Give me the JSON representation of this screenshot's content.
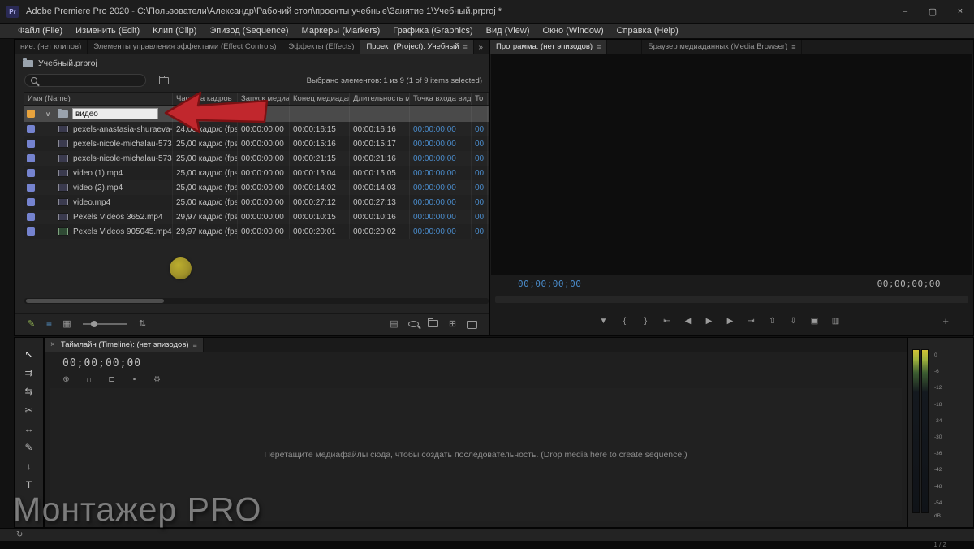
{
  "window": {
    "app_initials": "Pr",
    "title": "Adobe Premiere Pro 2020 - C:\\Пользователи\\Александр\\Рабочий стол\\проекты учебные\\Занятие 1\\Учебный.prproj *",
    "minimize": "–",
    "maximize": "▢",
    "close": "×"
  },
  "menu_bar": {
    "items": [
      "Файл (File)",
      "Изменить (Edit)",
      "Клип (Clip)",
      "Эпизод (Sequence)",
      "Маркеры (Markers)",
      "Графика (Graphics)",
      "Вид (View)",
      "Окно (Window)",
      "Справка (Help)"
    ]
  },
  "panels": {
    "left_tabs": [
      {
        "label": "ние: (нет клипов)",
        "active": false,
        "menu": false
      },
      {
        "label": "Элементы управления эффектами (Effect Controls)",
        "active": false,
        "menu": false
      },
      {
        "label": "Эффекты (Effects)",
        "active": false,
        "menu": false
      },
      {
        "label": "Проект (Project): Учебный",
        "active": true,
        "menu": true
      }
    ],
    "tabs_overflow": "»",
    "right_tabs": [
      {
        "label": "Программа: (нет эпизодов)",
        "active": true,
        "menu": true,
        "offset": false
      },
      {
        "label": "Браузер медиаданных (Media Browser)",
        "active": false,
        "menu": true,
        "offset": true
      }
    ]
  },
  "project_panel": {
    "project_name": "Учебный.prproj",
    "selection_status": "Выбрано элементов: 1 из 9 (1 of 9 items selected)",
    "columns": [
      "Имя (Name)",
      "Частота кадров",
      "Запуск медиадан",
      "Конец медиаданн",
      "Длительность ме",
      "Точка входа виде",
      "То"
    ],
    "bin_rename": {
      "value": "видео"
    },
    "rows": [
      {
        "name": "pexels-anastasia-shuraeva-",
        "fps": "24,00 кадр/с (fps)",
        "start": "00:00:00:00",
        "end": "00:00:16:15",
        "duration": "00:00:16:16",
        "in": "00:00:00:00",
        "more": "00"
      },
      {
        "name": "pexels-nicole-michalau-573",
        "fps": "25,00 кадр/с (fps)",
        "start": "00:00:00:00",
        "end": "00:00:15:16",
        "duration": "00:00:15:17",
        "in": "00:00:00:00",
        "more": "00"
      },
      {
        "name": "pexels-nicole-michalau-573",
        "fps": "25,00 кадр/с (fps)",
        "start": "00:00:00:00",
        "end": "00:00:21:15",
        "duration": "00:00:21:16",
        "in": "00:00:00:00",
        "more": "00"
      },
      {
        "name": "video (1).mp4",
        "fps": "25,00 кадр/с (fps)",
        "start": "00:00:00:00",
        "end": "00:00:15:04",
        "duration": "00:00:15:05",
        "in": "00:00:00:00",
        "more": "00"
      },
      {
        "name": "video (2).mp4",
        "fps": "25,00 кадр/с (fps)",
        "start": "00:00:00:00",
        "end": "00:00:14:02",
        "duration": "00:00:14:03",
        "in": "00:00:00:00",
        "more": "00"
      },
      {
        "name": "video.mp4",
        "fps": "25,00 кадр/с (fps)",
        "start": "00:00:00:00",
        "end": "00:00:27:12",
        "duration": "00:00:27:13",
        "in": "00:00:00:00",
        "more": "00"
      },
      {
        "name": "Pexels Videos 3652.mp4",
        "fps": "29,97 кадр/с (fps)",
        "start": "00:00:00:00",
        "end": "00:00:10:15",
        "duration": "00:00:10:16",
        "in": "00:00:00:00",
        "more": "00"
      },
      {
        "name": "Pexels Videos 905045.mp4",
        "fps": "29,97 кадр/с (fps)",
        "start": "00:00:00:00",
        "end": "00:00:20:01",
        "duration": "00:00:20:02",
        "in": "00:00:00:00",
        "more": "00",
        "icon": "green"
      }
    ],
    "toolbar": {
      "left_icons": [
        "writable",
        "list-view",
        "icon-view",
        "zoom-slider",
        "sort"
      ],
      "right_icons": [
        "automate-to-sequence",
        "find",
        "new-bin",
        "new-item",
        "clear"
      ]
    }
  },
  "program_monitor": {
    "timecode_left": "00;00;00;00",
    "timecode_right": "00;00;00;00",
    "transport_icons": [
      "add-marker",
      "mark-in",
      "mark-out",
      "go-to-in",
      "step-back",
      "play",
      "step-forward",
      "go-to-out",
      "lift",
      "extract",
      "export-frame",
      "comparison-view"
    ],
    "button_editor": "+"
  },
  "timeline": {
    "close": "×",
    "tab_label": "Таймлайн (Timeline): (нет эпизодов)",
    "panel_menu": "≡",
    "timecode": "00;00;00;00",
    "toolbar_icons": [
      "timeline-display-settings",
      "snap",
      "linked-selection",
      "marker",
      "settings-wrench"
    ],
    "tools": [
      {
        "name": "selection-tool",
        "active": true
      },
      {
        "name": "track-select-forward-tool",
        "active": false
      },
      {
        "name": "ripple-edit-tool",
        "active": false
      },
      {
        "name": "razor-tool",
        "active": false
      },
      {
        "name": "slip-tool",
        "active": false
      },
      {
        "name": "pen-tool",
        "active": false
      },
      {
        "name": "hand-tool",
        "active": false
      },
      {
        "name": "type-tool",
        "active": false
      }
    ],
    "drop_message": "Перетащите медиафайлы сюда, чтобы создать последовательность. (Drop media here to create sequence.)"
  },
  "audio_meter": {
    "ticks": [
      "0",
      "-6",
      "-12",
      "-18",
      "-24",
      "-30",
      "-36",
      "-42",
      "-48",
      "-54"
    ],
    "unit": "dB"
  },
  "status_bar": {
    "sync_icon": "↻"
  },
  "overlay": {
    "watermark": "Монтажер PRO",
    "page_indicator": "1 / 2"
  },
  "colors": {
    "accent_blue": "#4a8bca",
    "label_orange": "#e8a33d",
    "label_blue": "#7583cf",
    "arrow_red": "#c1272d",
    "highlight_row": "#4a4a4a"
  }
}
